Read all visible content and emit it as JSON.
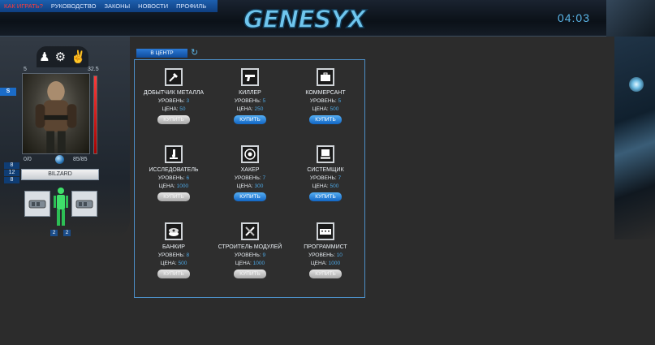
{
  "nav": {
    "items": [
      "КАК ИГРАТЬ?",
      "РУКОВОДСТВО",
      "ЗАКОНЫ",
      "НОВОСТИ",
      "ПРОФИЛЬ"
    ]
  },
  "logo_text": "GENESYX",
  "clock": "04:03",
  "player": {
    "icons": [
      "person-icon",
      "gears-icon",
      "hands-icon"
    ],
    "stat_min": "5",
    "stat_max": "32.5",
    "side_button": "S",
    "left_value": "0/0",
    "right_value": "85/85",
    "health_fill": 1.0,
    "mini": [
      "8",
      "12",
      "8"
    ],
    "name": "BILZARD",
    "equip_counts": [
      "2",
      "2"
    ]
  },
  "center_tab": "В ЦЕНТР",
  "labels": {
    "level": "УРОВЕНЬ: ",
    "price": "ЦЕНА: "
  },
  "professions": [
    {
      "title": "ДОБЫТЧИК МЕТАЛЛА",
      "level": "3",
      "price": "50",
      "buy": "КУПИТЬ",
      "active": false,
      "icon": "shovel-icon"
    },
    {
      "title": "КИЛЛЕР",
      "level": "5",
      "price": "250",
      "buy": "КУПИТЬ",
      "active": true,
      "icon": "gun-icon"
    },
    {
      "title": "КОММЕРСАНТ",
      "level": "5",
      "price": "500",
      "buy": "КУПИТЬ",
      "active": true,
      "icon": "briefcase-icon"
    },
    {
      "title": "ИССЛЕДОВАТЕЛЬ",
      "level": "6",
      "price": "1000",
      "buy": "КУПИТЬ",
      "active": false,
      "icon": "microscope-icon"
    },
    {
      "title": "ХАКЕР",
      "level": "7",
      "price": "300",
      "buy": "КУПИТЬ",
      "active": true,
      "icon": "target-icon"
    },
    {
      "title": "СИСТЕМЩИК",
      "level": "7",
      "price": "500",
      "buy": "КУПИТЬ",
      "active": true,
      "icon": "computer-icon"
    },
    {
      "title": "БАНКИР",
      "level": "8",
      "price": "500",
      "buy": "КУПИТЬ",
      "active": false,
      "icon": "money-icon"
    },
    {
      "title": "СТРОИТЕЛЬ МОДУЛЕЙ",
      "level": "9",
      "price": "1000",
      "buy": "КУПИТЬ",
      "active": false,
      "icon": "tools-icon"
    },
    {
      "title": "ПРОГРАММИСТ",
      "level": "10",
      "price": "1000",
      "buy": "КУПИТЬ",
      "active": false,
      "icon": "keyboard-icon"
    }
  ]
}
